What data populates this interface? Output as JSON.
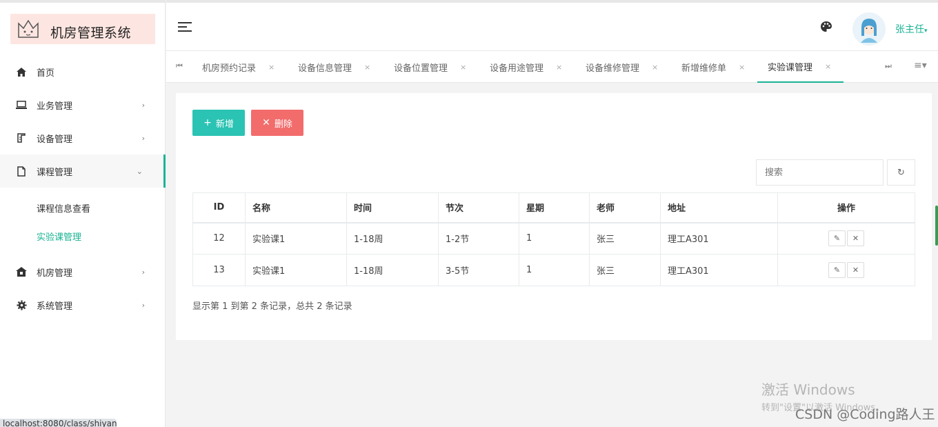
{
  "app": {
    "title": "机房管理系统",
    "user": "张主任"
  },
  "sidebar": {
    "items": [
      {
        "label": "首页",
        "icon": "home-icon",
        "has_arrow": false
      },
      {
        "label": "业务管理",
        "icon": "laptop-icon",
        "has_arrow": true
      },
      {
        "label": "设备管理",
        "icon": "device-icon",
        "has_arrow": true
      },
      {
        "label": "课程管理",
        "icon": "file-icon",
        "has_arrow": true,
        "expanded": true
      },
      {
        "label": "机房管理",
        "icon": "building-icon",
        "has_arrow": true
      },
      {
        "label": "系统管理",
        "icon": "gear-icon",
        "has_arrow": true
      }
    ],
    "sub_items": [
      {
        "label": "课程信息查看"
      },
      {
        "label": "实验课管理",
        "current": true
      }
    ]
  },
  "tabs": [
    {
      "label": "机房预约记录"
    },
    {
      "label": "设备信息管理"
    },
    {
      "label": "设备位置管理"
    },
    {
      "label": "设备用途管理"
    },
    {
      "label": "设备维修管理"
    },
    {
      "label": "新增维修单"
    },
    {
      "label": "实验课管理",
      "active": true
    }
  ],
  "toolbar": {
    "add_label": "新增",
    "delete_label": "删除"
  },
  "search": {
    "placeholder": "搜索"
  },
  "table": {
    "headers": [
      "ID",
      "名称",
      "时间",
      "节次",
      "星期",
      "老师",
      "地址",
      "操作"
    ],
    "rows": [
      [
        "12",
        "实验课1",
        "1-18周",
        "1-2节",
        "1",
        "张三",
        "理工A301"
      ],
      [
        "13",
        "实验课1",
        "1-18周",
        "3-5节",
        "1",
        "张三",
        "理工A301"
      ]
    ]
  },
  "pagination": {
    "summary": "显示第 1 到第 2 条记录，总共 2 条记录"
  },
  "overlay": {
    "activation_title": "激活 Windows",
    "activation_sub": "转到\"设置\"以激活 Windows。",
    "csdn": "CSDN @Coding路人王",
    "status_url": "localhost:8080/class/shiyan..."
  },
  "colors": {
    "accent": "#1ab394",
    "add": "#2bc3b3",
    "delete": "#f26c6c",
    "logo_bg": "#fde6e1"
  }
}
